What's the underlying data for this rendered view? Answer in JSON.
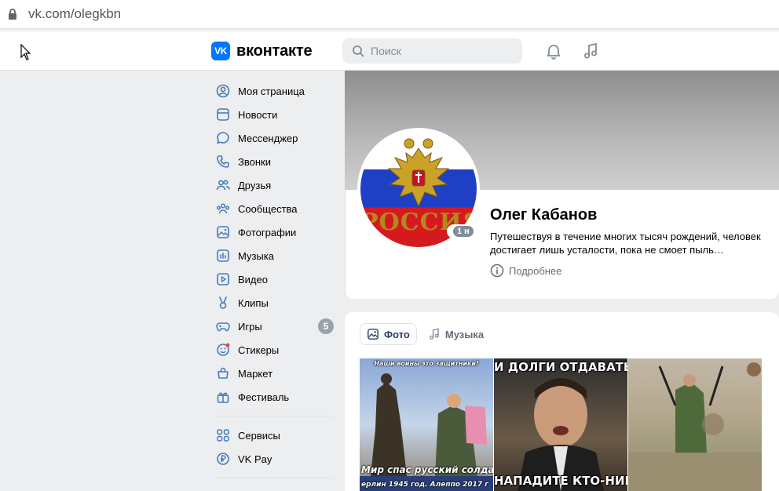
{
  "browser": {
    "url": "vk.com/olegkbn"
  },
  "header": {
    "logo_mark": "VK",
    "logo_text": "вконтакте",
    "search_placeholder": "Поиск"
  },
  "sidebar": {
    "items": [
      {
        "label": "Моя страница",
        "icon": "user-circle-icon"
      },
      {
        "label": "Новости",
        "icon": "newsfeed-icon"
      },
      {
        "label": "Мессенджер",
        "icon": "message-icon"
      },
      {
        "label": "Звонки",
        "icon": "phone-icon"
      },
      {
        "label": "Друзья",
        "icon": "friends-icon"
      },
      {
        "label": "Сообщества",
        "icon": "communities-icon"
      },
      {
        "label": "Фотографии",
        "icon": "photo-icon"
      },
      {
        "label": "Музыка",
        "icon": "music-icon"
      },
      {
        "label": "Видео",
        "icon": "video-icon"
      },
      {
        "label": "Клипы",
        "icon": "clips-icon"
      },
      {
        "label": "Игры",
        "icon": "gamepad-icon",
        "badge": "5"
      },
      {
        "label": "Стикеры",
        "icon": "sticker-icon"
      },
      {
        "label": "Маркет",
        "icon": "market-icon"
      },
      {
        "label": "Фестиваль",
        "icon": "gift-icon"
      }
    ],
    "extra": [
      {
        "label": "Сервисы",
        "icon": "services-icon"
      },
      {
        "label": "VK Pay",
        "icon": "vkpay-icon"
      }
    ]
  },
  "profile": {
    "avatar_text": "РОССИЯ",
    "online_badge": "1 н",
    "name": "Олег Кабанов",
    "status": "Путешествуя в течение многих тысяч рождений, человек достигает лишь усталости, пока не смоет пыль…",
    "more_label": "Подробнее"
  },
  "media": {
    "tabs": [
      {
        "label": "Фото",
        "icon": "photo-icon",
        "active": true
      },
      {
        "label": "Музыка",
        "icon": "music-icon",
        "active": false
      }
    ],
    "photos": [
      {
        "top_caption": "Наши воины это защитники!",
        "mid_caption": "Мир спас русский солдат",
        "bottom_caption": "ерлин 1945 год.    Алеппо 2017 г"
      },
      {
        "top_caption": "И ДОЛГИ ОТДАВАТЬ НА",
        "bottom_caption": "НАПАДИТЕ КТО-НИБУДЬ"
      },
      {
        "top_caption": "",
        "bottom_caption": ""
      }
    ]
  },
  "colors": {
    "accent": "#0077ff",
    "icon_blue": "#447bba",
    "page_bg": "#edeef0"
  }
}
